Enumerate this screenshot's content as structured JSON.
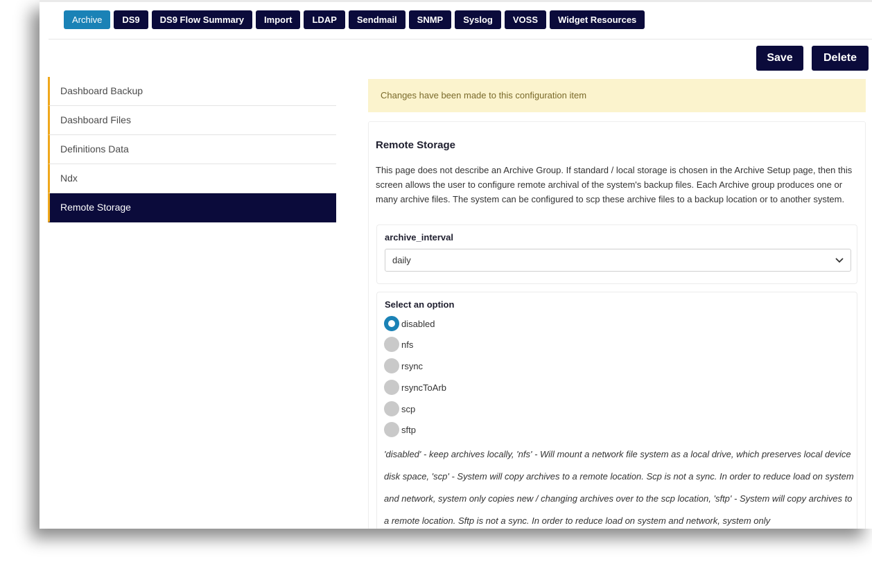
{
  "tabs": [
    {
      "label": "Archive",
      "active": true
    },
    {
      "label": "DS9",
      "active": false
    },
    {
      "label": "DS9 Flow Summary",
      "active": false
    },
    {
      "label": "Import",
      "active": false
    },
    {
      "label": "LDAP",
      "active": false
    },
    {
      "label": "Sendmail",
      "active": false
    },
    {
      "label": "SNMP",
      "active": false
    },
    {
      "label": "Syslog",
      "active": false
    },
    {
      "label": "VOSS",
      "active": false
    },
    {
      "label": "Widget Resources",
      "active": false
    }
  ],
  "toolbar": {
    "save_label": "Save",
    "delete_label": "Delete"
  },
  "sidebar": {
    "items": [
      {
        "label": "Dashboard Backup"
      },
      {
        "label": "Dashboard Files"
      },
      {
        "label": "Definitions Data"
      },
      {
        "label": "Ndx"
      },
      {
        "label": "Remote Storage"
      }
    ],
    "active": "Remote Storage"
  },
  "alert": {
    "text": "Changes have been made to this configuration item"
  },
  "section": {
    "title": "Remote Storage",
    "description": "This page does not describe an Archive Group. If standard / local storage is chosen in the Archive Setup page, then this screen allows the user to configure remote archival of the system's backup files. Each Archive group produces one or many archive files. The system can be configured to scp these archive files to a backup location or to another system."
  },
  "archive_interval": {
    "label": "archive_interval",
    "value": "daily"
  },
  "option_group": {
    "label": "Select an option",
    "options": [
      "disabled",
      "nfs",
      "rsync",
      "rsyncToArb",
      "scp",
      "sftp"
    ],
    "selected": "disabled",
    "help": "'disabled' - keep archives locally, 'nfs' - Will mount a network file system as a local drive, which preserves local device disk space, 'scp' - System will copy archives to a remote location. Scp is not a sync. In order to reduce load on system and network, system only copies new / changing archives over to the scp location, 'sftp' - System will copy archives to a remote location. Sftp is not a sync. In order to reduce load on system and network, system only"
  },
  "colors": {
    "accent": "#1a82b6",
    "navy": "#0b0b3b",
    "sidebar_marker": "#f0a81c",
    "alert_bg": "#fbf3cd"
  }
}
